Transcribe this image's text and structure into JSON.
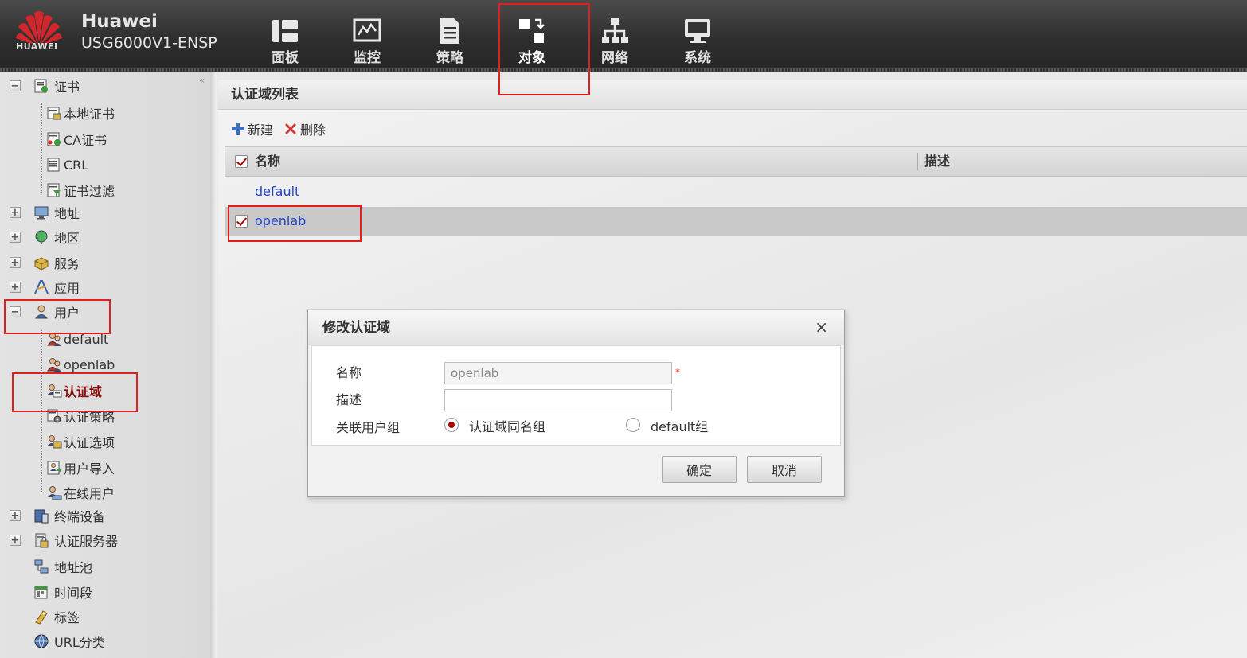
{
  "colors": {
    "header_bg": "#2e2e2e",
    "accent_red": "#b00000",
    "highlight_red": "#e0201e",
    "link_blue": "#2344c7",
    "selected_label": "#8b0d0d"
  },
  "header": {
    "logo_text": "HUAWEI",
    "brand_name": "Huawei",
    "model": "USG6000V1-ENSP",
    "nav": [
      {
        "label": "面板",
        "icon": "dashboard-icon"
      },
      {
        "label": "监控",
        "icon": "monitor-icon"
      },
      {
        "label": "策略",
        "icon": "policy-document-icon"
      },
      {
        "label": "对象",
        "icon": "object-icon"
      },
      {
        "label": "网络",
        "icon": "network-tree-icon"
      },
      {
        "label": "系统",
        "icon": "system-computer-icon"
      }
    ],
    "active_nav": "对象"
  },
  "sidebar": {
    "collapse_symbol": "«",
    "items": [
      {
        "label": "证书",
        "icon": "certificate-icon",
        "toggle": "−"
      },
      {
        "label": "本地证书",
        "icon": "local-certificate-icon"
      },
      {
        "label": "CA证书",
        "icon": "ca-certificate-icon"
      },
      {
        "label": "CRL",
        "icon": "crl-icon"
      },
      {
        "label": "证书过滤",
        "icon": "certificate-filter-icon"
      },
      {
        "label": "地址",
        "icon": "address-monitor-icon",
        "toggle": "+"
      },
      {
        "label": "地区",
        "icon": "region-globe-icon",
        "toggle": "+"
      },
      {
        "label": "服务",
        "icon": "service-box-icon",
        "toggle": "+"
      },
      {
        "label": "应用",
        "icon": "application-icon",
        "toggle": "+"
      },
      {
        "label": "用户",
        "icon": "user-icon",
        "toggle": "−"
      },
      {
        "label": "default",
        "icon": "user-group-icon"
      },
      {
        "label": "openlab",
        "icon": "user-group-icon"
      },
      {
        "label": "认证域",
        "icon": "auth-domain-icon"
      },
      {
        "label": "认证策略",
        "icon": "auth-policy-icon"
      },
      {
        "label": "认证选项",
        "icon": "auth-options-icon"
      },
      {
        "label": "用户导入",
        "icon": "user-import-icon"
      },
      {
        "label": "在线用户",
        "icon": "online-user-icon"
      },
      {
        "label": "终端设备",
        "icon": "terminal-device-icon",
        "toggle": "+"
      },
      {
        "label": "认证服务器",
        "icon": "auth-server-icon",
        "toggle": "+"
      },
      {
        "label": "地址池",
        "icon": "address-pool-icon"
      },
      {
        "label": "时间段",
        "icon": "time-range-icon"
      },
      {
        "label": "标签",
        "icon": "tag-icon"
      },
      {
        "label": "URL分类",
        "icon": "url-category-icon"
      }
    ],
    "selected": "认证域"
  },
  "content": {
    "title": "认证域列表",
    "toolbar": {
      "new_label": "新建",
      "delete_label": "删除"
    },
    "table": {
      "columns": [
        "名称",
        "描述"
      ],
      "rows": [
        {
          "name": "default",
          "description": "",
          "checked": false
        },
        {
          "name": "openlab",
          "description": "",
          "checked": true
        }
      ]
    }
  },
  "dialog": {
    "title": "修改认证域",
    "close_symbol": "×",
    "fields": {
      "name_label": "名称",
      "name_value": "openlab",
      "required_mark": "*",
      "desc_label": "描述",
      "desc_value": "",
      "group_label": "关联用户组",
      "group_options": [
        "认证域同名组",
        "default组"
      ],
      "group_selected": "认证域同名组"
    },
    "ok_label": "确定",
    "cancel_label": "取消"
  }
}
